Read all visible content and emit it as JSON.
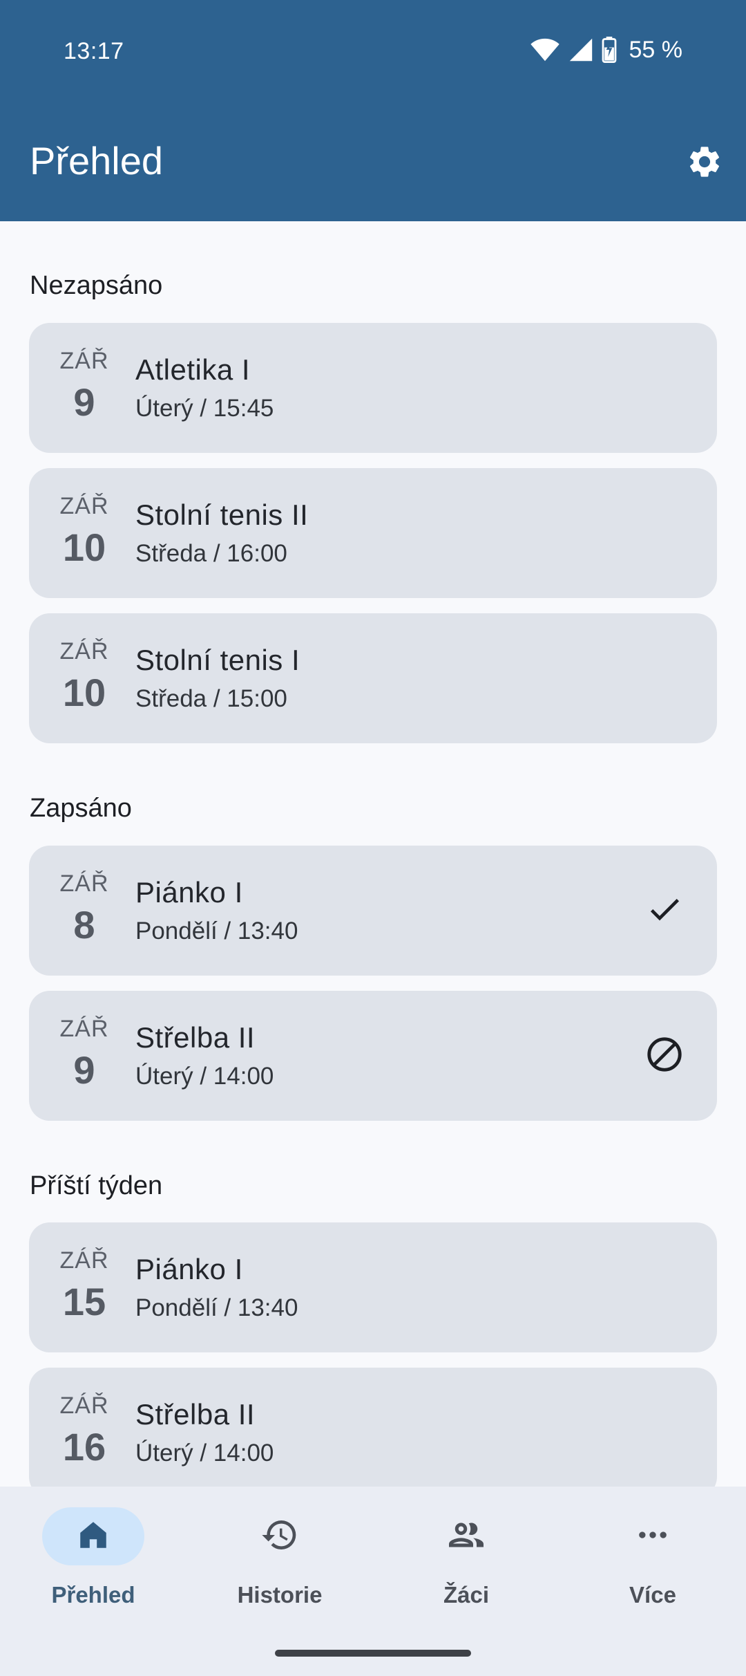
{
  "status_bar": {
    "time": "13:17",
    "battery": "55 %"
  },
  "app_bar": {
    "title": "Přehled"
  },
  "sections": {
    "unregistered": {
      "title": "Nezapsáno"
    },
    "registered": {
      "title": "Zapsáno"
    },
    "next_week": {
      "title": "Příští týden"
    }
  },
  "cards": [
    {
      "month": "ZÁŘ",
      "day": "9",
      "name": "Atletika I",
      "sub": "Úterý / 15:45"
    },
    {
      "month": "ZÁŘ",
      "day": "10",
      "name": "Stolní tenis II",
      "sub": "Středa / 16:00"
    },
    {
      "month": "ZÁŘ",
      "day": "10",
      "name": "Stolní tenis I",
      "sub": "Středa / 15:00"
    },
    {
      "month": "ZÁŘ",
      "day": "8",
      "name": "Piánko I",
      "sub": "Pondělí / 13:40",
      "status_icon": "check-icon"
    },
    {
      "month": "ZÁŘ",
      "day": "9",
      "name": "Střelba II",
      "sub": "Úterý / 14:00",
      "status_icon": "block-icon"
    },
    {
      "month": "ZÁŘ",
      "day": "15",
      "name": "Piánko I",
      "sub": "Pondělí / 13:40"
    },
    {
      "month": "ZÁŘ",
      "day": "16",
      "name": "Střelba II",
      "sub": "Úterý / 14:00"
    }
  ],
  "bottom_nav": [
    {
      "label": "Přehled",
      "icon": "home-icon",
      "active": true
    },
    {
      "label": "Historie",
      "icon": "history-icon",
      "active": false
    },
    {
      "label": "Žáci",
      "icon": "people-icon",
      "active": false
    },
    {
      "label": "Více",
      "icon": "more-icon",
      "active": false
    }
  ],
  "colors": {
    "app_bar": "#2d6290",
    "background": "#f8f9fc",
    "card": "#dfe3ea",
    "nav_active_pill": "#cfe5fb"
  }
}
